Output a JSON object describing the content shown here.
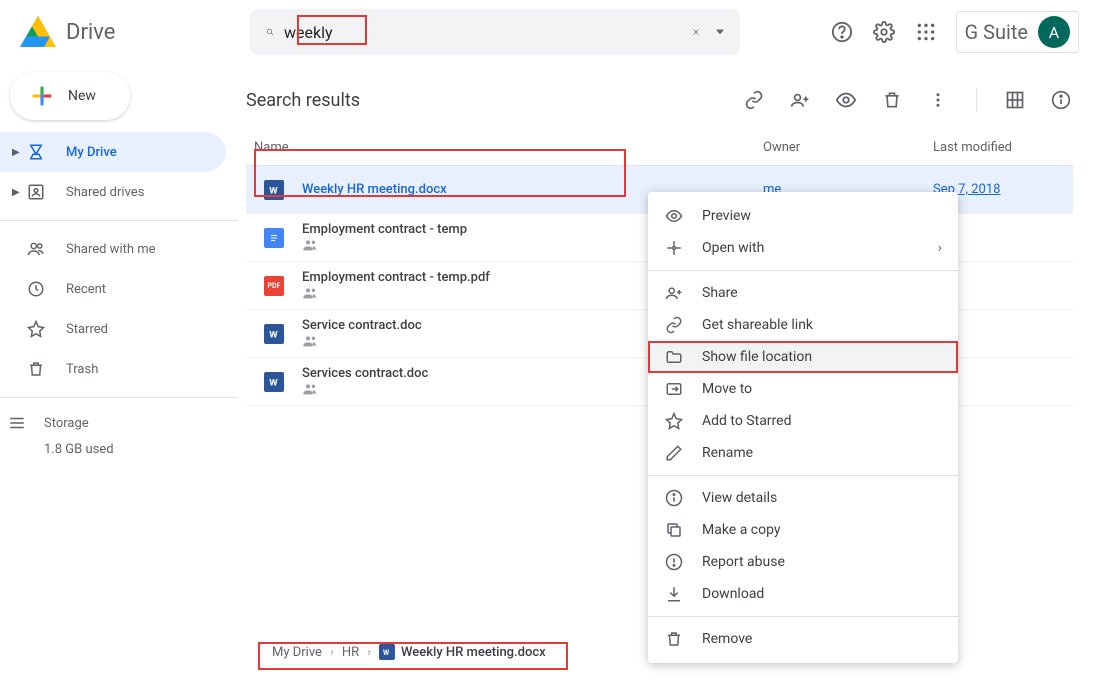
{
  "app": {
    "name": "Drive"
  },
  "search": {
    "value": "weekly"
  },
  "gsuite": {
    "text": "G Suite",
    "avatar_initial": "A"
  },
  "new_button": "New",
  "sidebar": {
    "my_drive": "My Drive",
    "shared_drives": "Shared drives",
    "shared_with_me": "Shared with me",
    "recent": "Recent",
    "starred": "Starred",
    "trash": "Trash",
    "storage": "Storage",
    "storage_used": "1.8 GB used"
  },
  "page_title": "Search results",
  "columns": {
    "name": "Name",
    "owner": "Owner",
    "modified": "Last modified"
  },
  "files": [
    {
      "name": "Weekly HR meeting.docx",
      "owner": "me",
      "modified": "Sep 7, 2018",
      "type": "word",
      "shared": false,
      "selected": true
    },
    {
      "name": "Employment contract - temp",
      "owner": "",
      "modified": "",
      "type": "gdoc",
      "shared": true
    },
    {
      "name": "Employment contract - temp.pdf",
      "owner": "",
      "modified": "",
      "type": "pdf",
      "shared": true
    },
    {
      "name": "Service contract.doc",
      "owner": "",
      "modified": "",
      "type": "word",
      "shared": true
    },
    {
      "name": "Services contract.doc",
      "owner": "",
      "modified": "",
      "type": "word",
      "shared": true
    }
  ],
  "context_menu": {
    "preview": "Preview",
    "open_with": "Open with",
    "share": "Share",
    "get_link": "Get shareable link",
    "show_location": "Show file location",
    "move_to": "Move to",
    "add_starred": "Add to Starred",
    "rename": "Rename",
    "view_details": "View details",
    "make_copy": "Make a copy",
    "report_abuse": "Report abuse",
    "download": "Download",
    "remove": "Remove"
  },
  "breadcrumb": {
    "root": "My Drive",
    "folder": "HR",
    "file": "Weekly HR meeting.docx"
  }
}
